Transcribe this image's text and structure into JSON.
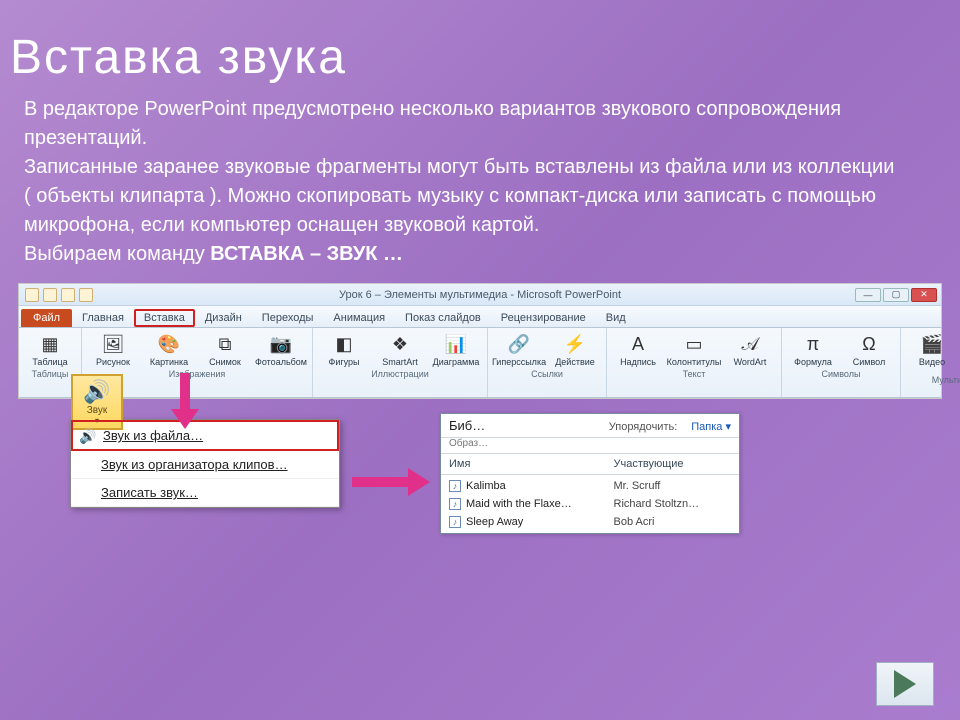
{
  "title": "Вставка звука",
  "body": {
    "p1": "В редакторе PowerPoint предусмотрено несколько вариантов звукового сопровождения презентаций.",
    "p2": "Записанные заранее звуковые фрагменты могут быть вставлены из файла или из коллекции ( объекты клипарта ). Можно скопировать музыку с компакт-диска или записать с помощью микрофона, если компьютер оснащен звуковой картой.",
    "p3_prefix": "Выбираем команду ",
    "p3_bold": "ВСТАВКА – ЗВУК …"
  },
  "window": {
    "caption": "Урок 6 – Элементы мультимедиа  -  Microsoft PowerPoint"
  },
  "tabs": {
    "file": "Файл",
    "home": "Главная",
    "insert": "Вставка",
    "design": "Дизайн",
    "transitions": "Переходы",
    "animations": "Анимация",
    "slideshow": "Показ слайдов",
    "review": "Рецензирование",
    "view": "Вид"
  },
  "groups": {
    "tables": {
      "title": "Таблицы",
      "table": "Таблица"
    },
    "images": {
      "title": "Изображения",
      "picture": "Рисунок",
      "clipart": "Картинка",
      "screenshot": "Снимок",
      "album": "Фотоальбом"
    },
    "illustrations": {
      "title": "Иллюстрации",
      "shapes": "Фигуры",
      "smartart": "SmartArt",
      "chart": "Диаграмма"
    },
    "links": {
      "title": "Ссылки",
      "hyperlink": "Гиперссылка",
      "action": "Действие"
    },
    "text": {
      "title": "Текст",
      "textbox": "Надпись",
      "headerfooter": "Колонтитулы",
      "wordart": "WordArt",
      "formula": "Формула",
      "symbol": "Символ"
    },
    "symbols": {
      "title": "Символы"
    },
    "media": {
      "title": "Мультимедиа",
      "video": "Видео",
      "audio": "Звук"
    }
  },
  "sound_button": {
    "label": "Звук"
  },
  "sound_menu": {
    "from_file": "Звук из файла…",
    "from_organizer": "Звук из организатора клипов…",
    "record": "Записать звук…"
  },
  "dialog": {
    "crumb": "Биб…",
    "crumb2": "Образ…",
    "sort_label": "Упорядочить:",
    "folder": "Папка ▾",
    "col_name": "Имя",
    "col_artist": "Участвующие",
    "rows": [
      {
        "name": "Kalimba",
        "artist": "Mr. Scruff"
      },
      {
        "name": "Maid with the Flaxe…",
        "artist": "Richard Stoltzn…"
      },
      {
        "name": "Sleep Away",
        "artist": "Bob Acri"
      }
    ]
  }
}
